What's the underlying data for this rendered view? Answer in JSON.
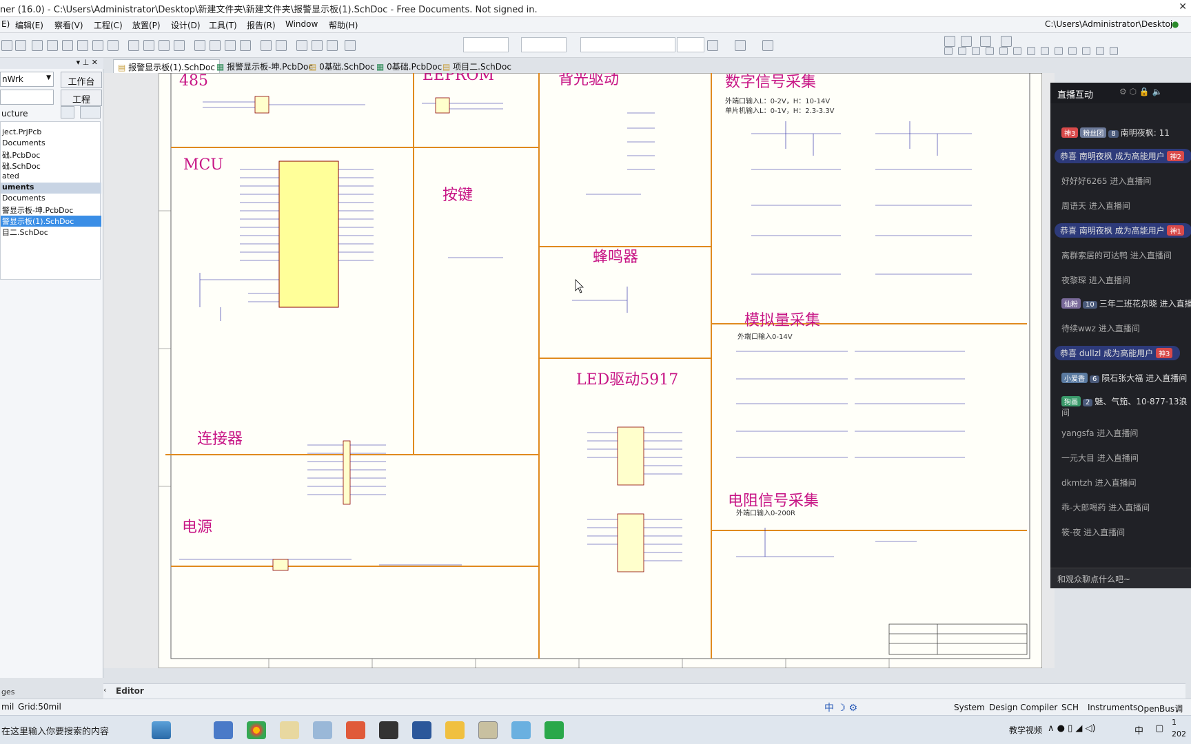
{
  "titlebar": {
    "text": "ner (16.0) - C:\\Users\\Administrator\\Desktop\\新建文件夹\\新建文件夹\\报警显示板(1).SchDoc - Free Documents. Not signed in."
  },
  "menu": [
    "E)",
    "编辑(E)",
    "察看(V)",
    "工程(C)",
    "放置(P)",
    "设计(D)",
    "工具(T)",
    "报告(R)",
    "Window",
    "帮助(H)"
  ],
  "topright_path": "C:\\Users\\Administrator\\Desktoj",
  "leftpanel": {
    "workspace": "nWrk",
    "workspace_btn": "工作台",
    "project_btn": "工程",
    "structure_label": "ucture",
    "rows": [
      "ject.PrjPcb",
      "Documents",
      "础.PcbDoc",
      "础.SchDoc",
      "ated",
      "uments",
      "Documents",
      "警显示板-坤.PcbDoc",
      "警显示板(1).SchDoc",
      "目二.SchDoc"
    ],
    "bottom_label": "ges"
  },
  "doctabs": [
    "报警显示板(1).SchDoc",
    "报警显示板-坤.PcbDoc",
    "0基础.SchDoc",
    "0基础.PcbDoc",
    "项目二.SchDoc"
  ],
  "sections": {
    "s485": "485",
    "eeprom": "EEPROM",
    "backlight": "背光驱动",
    "digital": "数字信号采集",
    "digital_sub1": "外端口输入L：0-2V，H：10-14V",
    "digital_sub2": "单片机输入L：0-1V，H：2.3-3.3V",
    "mcu": "MCU",
    "key": "按键",
    "buzzer": "蜂鸣器",
    "analog": "模拟量采集",
    "analog_sub": "外端口输入0-14V",
    "led": "LED驱动5917",
    "connector": "连接器",
    "power": "电源",
    "resistor": "电阻信号采集",
    "resistor_sub": "外端口输入0-200R"
  },
  "live": {
    "title": "直播互动",
    "rows": [
      {
        "badge": "神3",
        "badge2": "粉丝团",
        "num": "8",
        "text": "南明夜枫: 11"
      },
      {
        "text": "恭喜 南明夜枫 成为高能用户",
        "tag": "神2"
      },
      {
        "text": "好好好6265 进入直播间"
      },
      {
        "text": "周语天 进入直播间"
      },
      {
        "text": "恭喜 南明夜枫 成为高能用户",
        "tag": "神1"
      },
      {
        "text": "离群索居的可达鸭 进入直播间"
      },
      {
        "text": "夜黎琛 进入直播间"
      },
      {
        "badge": "仙粉",
        "num": "10",
        "text": "三年二班花京晓 进入直播"
      },
      {
        "text": "待续wwz 进入直播间"
      },
      {
        "text": "恭喜 dullzl 成为高能用户",
        "tag": "神3"
      },
      {
        "badge": "小爱香",
        "num": "6",
        "text": "陨石张大福 进入直播间"
      },
      {
        "badge": "狗画",
        "num": "2",
        "text": "魅、气笳、10-877-13浪"
      },
      {
        "text": "间"
      },
      {
        "text": "yangsfa 进入直播间"
      },
      {
        "text": "一元大目 进入直播间"
      },
      {
        "text": "dkmtzh 进入直播间"
      },
      {
        "text": "乖-大郎喝药 进入直播间"
      },
      {
        "text": "筱-夜 进入直播间"
      }
    ],
    "chat_placeholder": "和观众聊点什么吧~"
  },
  "bottomtab": "Editor",
  "status": {
    "mil": "mil",
    "grid": "Grid:50mil",
    "right": [
      "System",
      "Design Compiler",
      "SCH",
      "Instruments",
      "OpenBus调色板"
    ]
  },
  "taskbar": {
    "search": "在这里输入你要搜索的内容",
    "tray": "教学视频",
    "ime": "中",
    "time": "1",
    "date": "202"
  }
}
